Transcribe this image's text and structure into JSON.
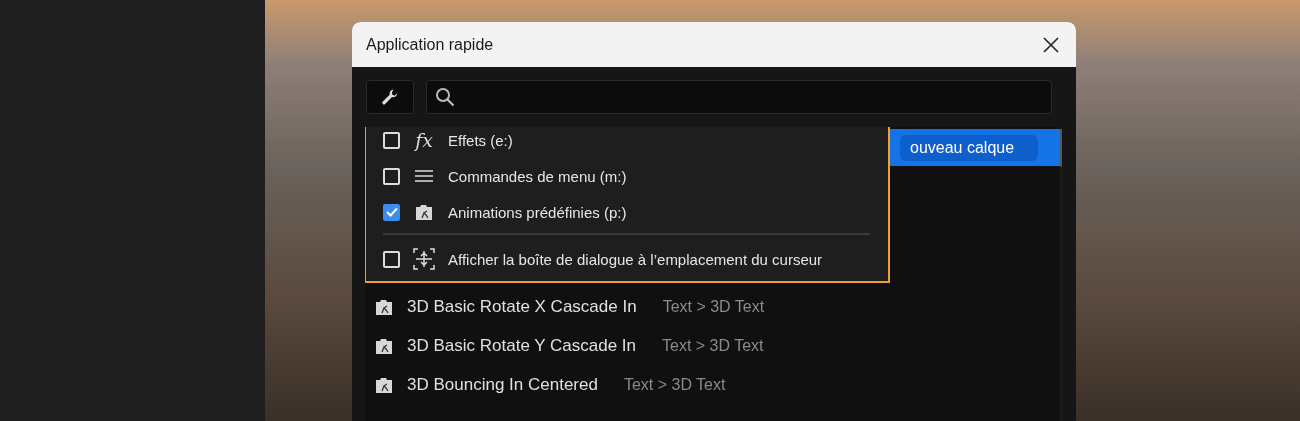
{
  "window": {
    "title": "Application rapide"
  },
  "menu": {
    "items": [
      {
        "kind": "source",
        "glyph": "fx",
        "label": "Effets (e:)",
        "checked": false
      },
      {
        "kind": "source",
        "label": "Commandes de menu (m:)",
        "checked": false
      },
      {
        "kind": "source",
        "label": "Animations prédéfinies (p:)",
        "checked": true
      },
      {
        "kind": "setting",
        "label": "Afficher la boîte de dialogue à l’emplacement du curseur",
        "checked": false
      }
    ]
  },
  "results": [
    {
      "name": "ouveau calque",
      "selected": true
    },
    {
      "name": "3D Basic Rotate X Cascade In",
      "category": "Text > 3D Text",
      "selected": false
    },
    {
      "name": "3D Basic Rotate Y Cascade In",
      "category": "Text > 3D Text",
      "selected": false
    },
    {
      "name": "3D Bouncing In Centered",
      "category": "Text > 3D Text",
      "selected": false
    }
  ]
}
